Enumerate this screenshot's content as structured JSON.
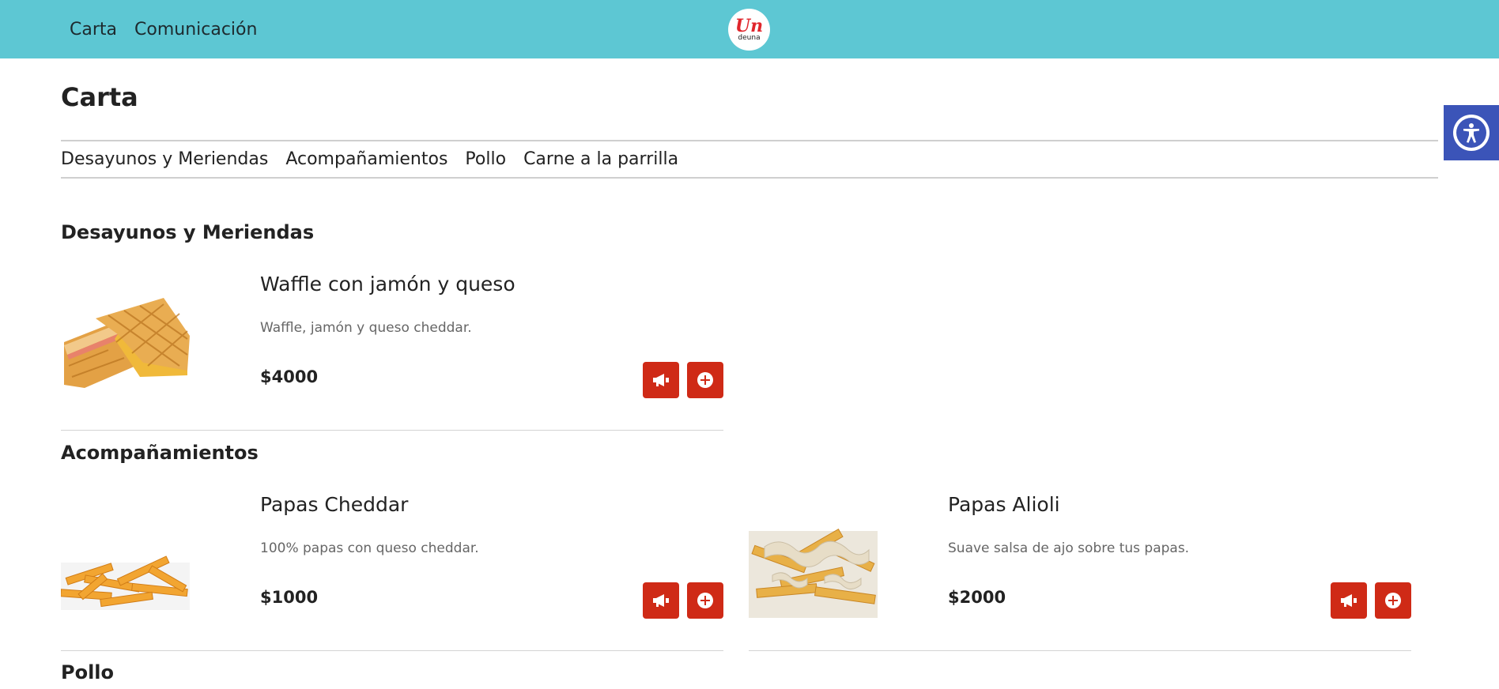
{
  "nav": {
    "items": [
      "Carta",
      "Comunicación"
    ],
    "logo_mark": "Un",
    "logo_word": "deuna"
  },
  "page": {
    "title": "Carta"
  },
  "categories": [
    "Desayunos y Meriendas",
    "Acompañamientos",
    "Pollo",
    "Carne a la parrilla"
  ],
  "sections": [
    {
      "title": "Desayunos y Meriendas",
      "items": [
        {
          "name": "Waffle con jamón y queso",
          "description": "Waffle, jamón y queso cheddar.",
          "price": "$4000",
          "image": "waffle-sandwich"
        }
      ]
    },
    {
      "title": "Acompañamientos",
      "items": [
        {
          "name": "Papas Cheddar",
          "description": "100% papas con queso cheddar.",
          "price": "$1000",
          "image": "fries-cheddar"
        },
        {
          "name": "Papas Alioli",
          "description": "Suave salsa de ajo sobre tus papas.",
          "price": "$2000",
          "image": "fries-alioli"
        }
      ]
    },
    {
      "title": "Pollo",
      "items": []
    }
  ],
  "icons": {
    "announce": "megaphone-icon",
    "add": "plus-circle-icon",
    "accessibility": "accessibility-icon"
  },
  "colors": {
    "header": "#5dc7d3",
    "action_button": "#cf2a16",
    "accessibility_button": "#3b54b8"
  }
}
